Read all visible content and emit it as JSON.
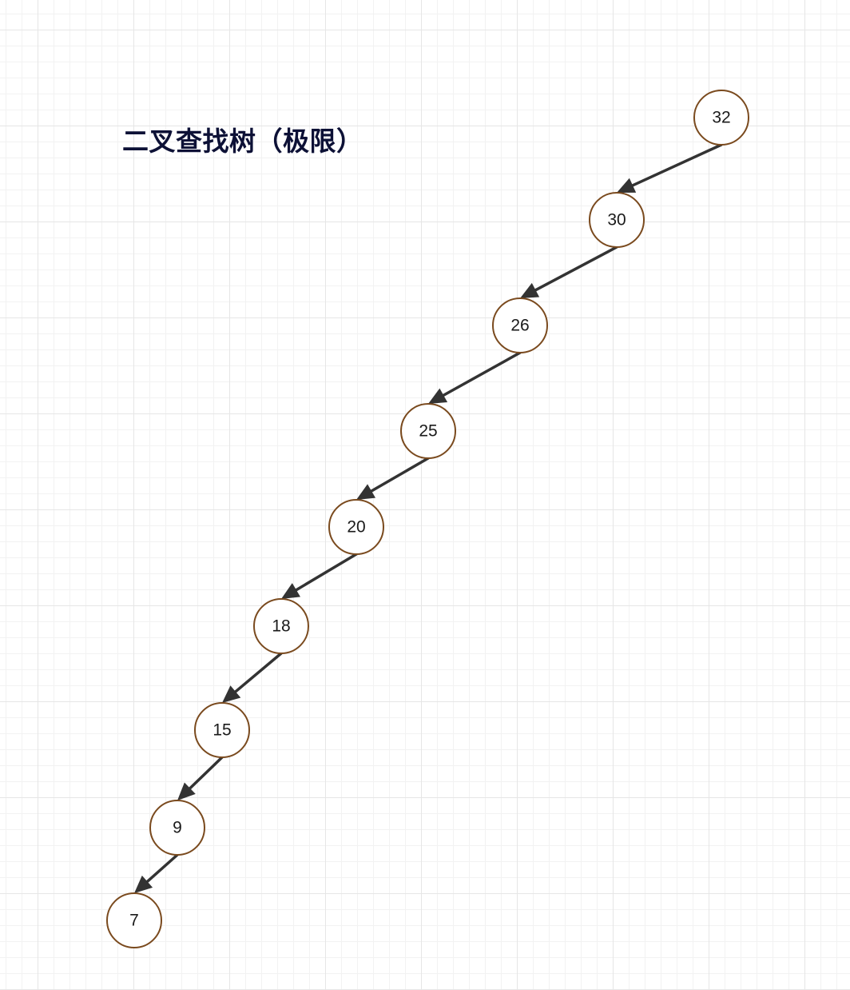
{
  "title": "二叉查找树（极限）",
  "colors": {
    "node_border": "#7a4a1e",
    "edge": "#333333",
    "title": "#0d1136"
  },
  "tree": {
    "nodes": [
      {
        "id": "n32",
        "label": "32"
      },
      {
        "id": "n30",
        "label": "30"
      },
      {
        "id": "n26",
        "label": "26"
      },
      {
        "id": "n25",
        "label": "25"
      },
      {
        "id": "n20",
        "label": "20"
      },
      {
        "id": "n18",
        "label": "18"
      },
      {
        "id": "n15",
        "label": "15"
      },
      {
        "id": "n9",
        "label": "9"
      },
      {
        "id": "n7",
        "label": "7"
      }
    ],
    "edges": [
      {
        "from": "n32",
        "to": "n30"
      },
      {
        "from": "n30",
        "to": "n26"
      },
      {
        "from": "n26",
        "to": "n25"
      },
      {
        "from": "n25",
        "to": "n20"
      },
      {
        "from": "n20",
        "to": "n18"
      },
      {
        "from": "n18",
        "to": "n15"
      },
      {
        "from": "n15",
        "to": "n9"
      },
      {
        "from": "n9",
        "to": "n7"
      }
    ]
  }
}
